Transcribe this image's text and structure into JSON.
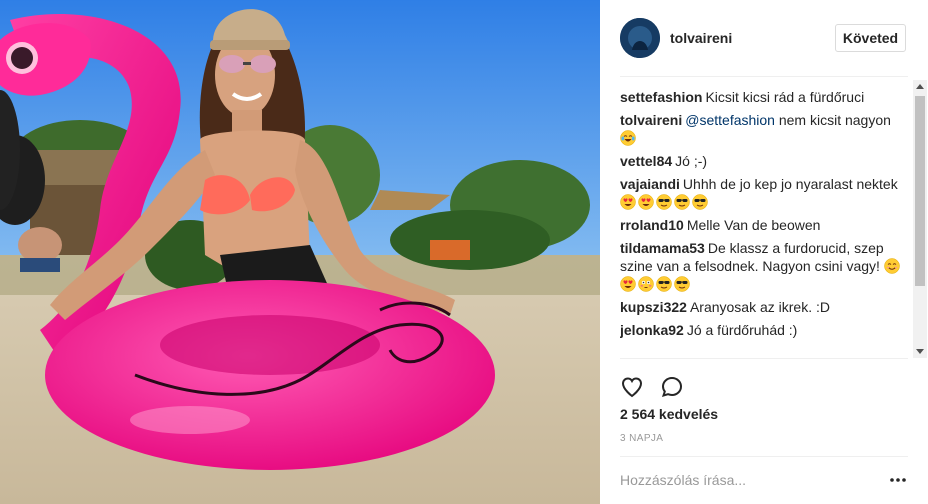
{
  "post": {
    "author": "tolvaireni",
    "follow_label": "Követed",
    "likes": "2 564 kedvelés",
    "time": "3 NAPJA",
    "comment_placeholder": "Hozzászólás írása..."
  },
  "photo": {
    "icon": "photo-woman-with-pink-flamingo-float",
    "colors": {
      "sky": "#3f8ee8",
      "flamingo": "#ff1f8e",
      "bikini_top": "#ff6b5b"
    }
  },
  "comments": [
    {
      "user": "settefashion",
      "text": "Kicsit kicsi rád a fürdőruci",
      "emojis": []
    },
    {
      "user": "tolvaireni",
      "mention": "@settefashion",
      "text": " nem kicsit nagyon",
      "emojis": [
        "tears-of-joy"
      ]
    },
    {
      "user": "vettel84",
      "text": "Jó ;-)",
      "emojis": []
    },
    {
      "user": "vajaiandi",
      "text": "Uhhh de jo kep jo nyaralast nektek",
      "emojis": [
        "heart-eyes",
        "heart-eyes",
        "sunglasses",
        "sunglasses",
        "sunglasses"
      ]
    },
    {
      "user": "rroland10",
      "text": "Melle Van de beowen",
      "emojis": []
    },
    {
      "user": "tildamama53",
      "text": "De klassz a furdorucid, szep szine van a felsodnek. Nagyon csini vagy!",
      "emojis": [
        "smiling",
        "heart-eyes",
        "flushed",
        "sunglasses",
        "sunglasses"
      ]
    },
    {
      "user": "kupszi322",
      "text": "Aranyosak az ikrek. :D",
      "emojis": []
    },
    {
      "user": "jelonka92",
      "text": "Jó a fürdőruhád :)",
      "emojis": []
    }
  ]
}
